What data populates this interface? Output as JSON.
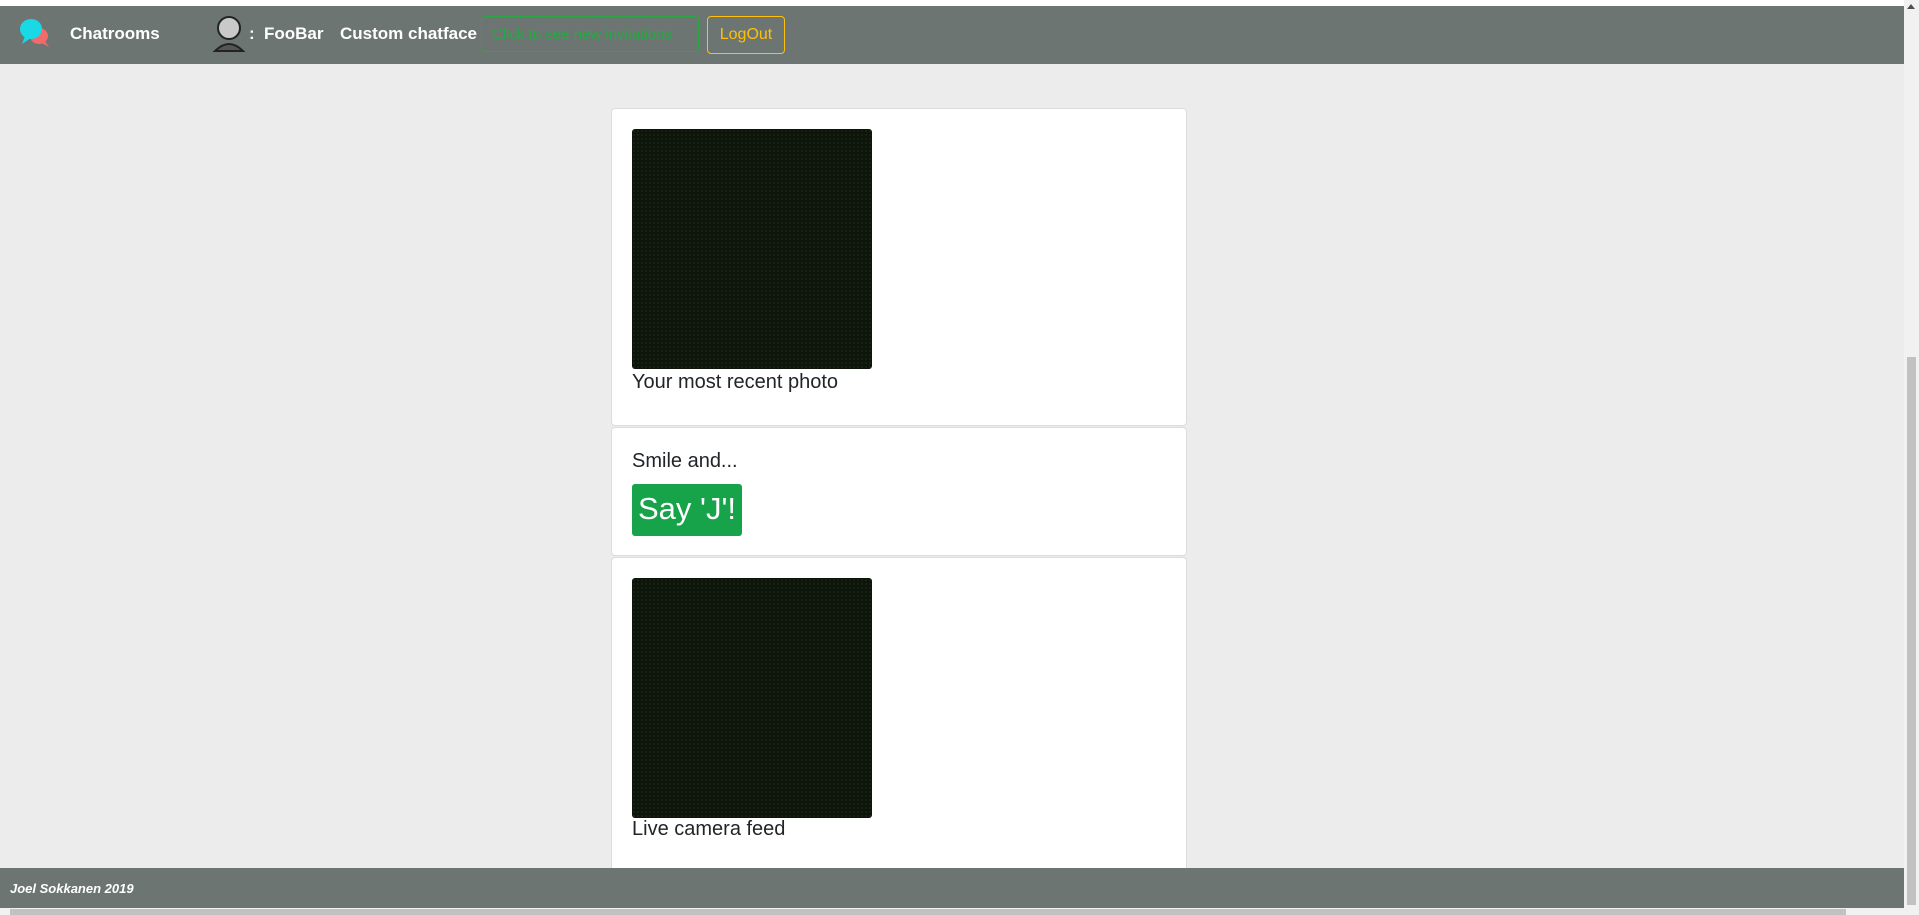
{
  "nav": {
    "brand": "Chatrooms",
    "separator": ":",
    "username": "FooBar",
    "custom_chatface": "Custom chatface",
    "invite_button": "Click to see new invitations",
    "logout_button": "LogOut"
  },
  "cards": {
    "recent_photo_caption": "Your most recent photo",
    "smile_text": "Smile and...",
    "say_button": "Say 'J'!",
    "live_feed_caption": "Live camera feed"
  },
  "footer": {
    "text": "Joel Sokkanen 2019"
  },
  "icons": {
    "brand": "chat-bubbles-icon",
    "user": "user-avatar-icon"
  },
  "colors": {
    "navbar": "#6c7572",
    "success": "#28a745",
    "warning": "#ffc107",
    "say_button": "#17a34a"
  }
}
